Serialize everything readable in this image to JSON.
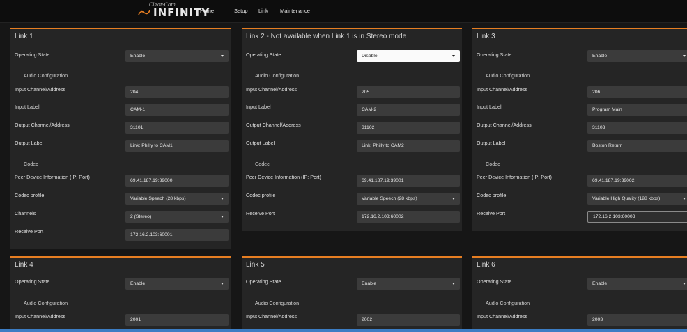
{
  "header": {
    "logo_text": "INFINITY",
    "logo_script": "Clear-Com",
    "nav": [
      "Home",
      "Setup",
      "Link",
      "Maintenance"
    ]
  },
  "labels": {
    "operating_state": "Operating State",
    "audio_config": "Audio Configuration",
    "input_channel": "Input Channel/Address",
    "input_label": "Input Label",
    "output_channel": "Output Channel/Address",
    "output_label": "Output Label",
    "codec": "Codec",
    "peer_device": "Peer Device Information (IP: Port)",
    "codec_profile": "Codec profile",
    "channels": "Channels",
    "receive_port": "Receive Port"
  },
  "links": [
    {
      "title": "Link 1",
      "operating_state": "Enable",
      "input_channel": "204",
      "input_label": "CAM-1",
      "output_channel": "31101",
      "output_label": "Link: Philly to CAM1",
      "peer_device": "69.41.187.19:39000",
      "codec_profile": "Variable Speech (28 kbps)",
      "channels": "2 (Stereo)",
      "receive_port": "172.16.2.103:60001"
    },
    {
      "title": "Link 2 - Not available when Link 1 is in Stereo mode",
      "operating_state": "Disable",
      "input_channel": "205",
      "input_label": "CAM-2",
      "output_channel": "31102",
      "output_label": "Link: Philly to CAM2",
      "peer_device": "69.41.187.19:39001",
      "codec_profile": "Variable Speech (28 kbps)",
      "receive_port": "172.16.2.103:60002"
    },
    {
      "title": "Link 3",
      "operating_state": "Enable",
      "input_channel": "206",
      "input_label": "Program Main",
      "output_channel": "31103",
      "output_label": "Boston Return",
      "peer_device": "69.41.187.19:39002",
      "codec_profile": "Variable High Quality (128 kbps)",
      "receive_port": "172.16.2.103:60003"
    },
    {
      "title": "Link 4",
      "operating_state": "Enable",
      "input_channel": "2001"
    },
    {
      "title": "Link 5",
      "operating_state": "Enable",
      "input_channel": "2002"
    },
    {
      "title": "Link 6",
      "operating_state": "Enable",
      "input_channel": "2003"
    }
  ]
}
